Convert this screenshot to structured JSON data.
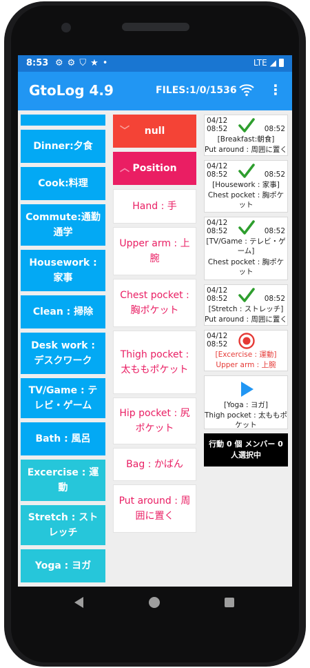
{
  "status_bar": {
    "time": "8:53",
    "icons": [
      "gear-icon",
      "gear-icon",
      "shield-icon",
      "star-icon",
      "dot-icon"
    ],
    "network": "LTE"
  },
  "app_bar": {
    "title": "GtoLog 4.9",
    "files": "FILES:1/0/1536"
  },
  "activities": [
    {
      "label": "Dinner:夕食",
      "color": "#03a9f4"
    },
    {
      "label": "Cook:料理",
      "color": "#03a9f4"
    },
    {
      "label": "Commute:通勤通学",
      "color": "#03a9f4"
    },
    {
      "label": "Housework : 家事",
      "color": "#03a9f4"
    },
    {
      "label": "Clean : 掃除",
      "color": "#03a9f4"
    },
    {
      "label": "Desk work : デスクワーク",
      "color": "#03a9f4"
    },
    {
      "label": "TV/Game : テレビ・ゲーム",
      "color": "#03a9f4"
    },
    {
      "label": "Bath : 風呂",
      "color": "#03a9f4"
    },
    {
      "label": "Excercise : 運動",
      "color": "#26c6da"
    },
    {
      "label": "Stretch : ストレッチ",
      "color": "#26c6da"
    },
    {
      "label": "Yoga : ヨガ",
      "color": "#26c6da"
    }
  ],
  "headers": {
    "null_label": "null",
    "position_label": "Position"
  },
  "positions": [
    "Hand : 手",
    "Upper arm : 上腕",
    "Chest pocket : 胸ポケット",
    "Thigh pocket : 太ももポケット",
    "Hip pocket : 尻ポケット",
    "Bag : かばん",
    "Put around : 周囲に置く"
  ],
  "log": [
    {
      "date": "04/12",
      "start": "08:52",
      "end": "08:52",
      "status": "done",
      "activity": "[Breakfast:朝食]",
      "position": "Put around : 周囲に置く"
    },
    {
      "date": "04/12",
      "start": "08:52",
      "end": "08:52",
      "status": "done",
      "activity": "[Housework : 家事]",
      "position": "Chest pocket : 胸ポケット"
    },
    {
      "date": "04/12",
      "start": "08:52",
      "end": "08:52",
      "status": "done",
      "activity": "[TV/Game : テレビ・ゲーム]",
      "position": "Chest pocket : 胸ポケット"
    },
    {
      "date": "04/12",
      "start": "08:52",
      "end": "08:52",
      "status": "done",
      "activity": "[Stretch : ストレッチ]",
      "position": "Put around : 周囲に置く"
    },
    {
      "date": "04/12",
      "start": "08:52",
      "end": "",
      "status": "recording",
      "activity": "[Excercise : 運動]",
      "position": "Upper arm : 上腕"
    },
    {
      "date": "",
      "start": "",
      "end": "",
      "status": "play",
      "activity": "[Yoga : ヨガ]",
      "position": "Thigh pocket : 太ももポケット"
    }
  ],
  "selection_status": "行動 0 個 メンバー 0 人選択中",
  "colors": {
    "status_bar": "#1976d2",
    "app_bar": "#2196f3",
    "activity_blue": "#03a9f4",
    "activity_teal": "#26c6da",
    "null_red": "#f44336",
    "position_pink": "#ea1e63",
    "position_text": "#e91e63",
    "check_green": "#2e9e2e",
    "record_red": "#e53935",
    "play_blue": "#2196f3"
  }
}
